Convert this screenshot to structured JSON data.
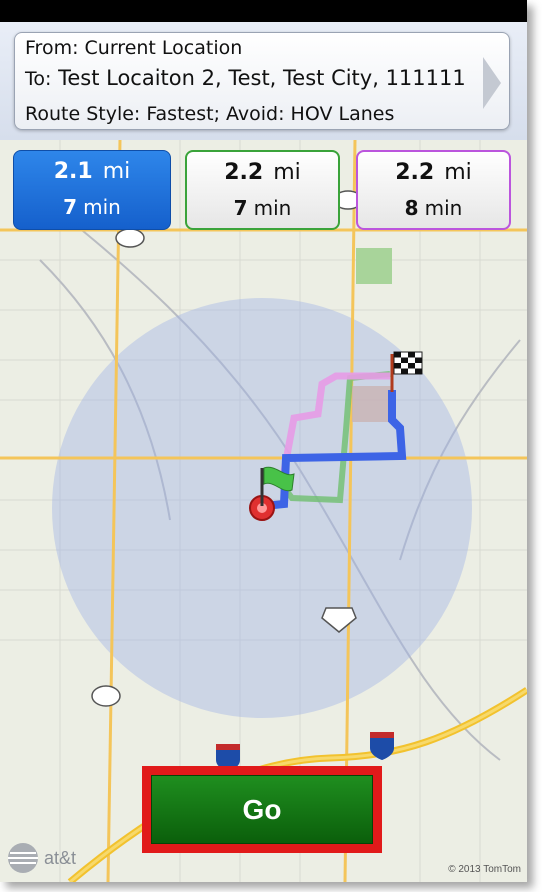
{
  "route": {
    "from_text": "From: Current Location",
    "to_label": "To:",
    "to_value": "Test Locaiton 2, Test, Test City, 111111",
    "style_text": "Route Style: Fastest; Avoid: HOV Lanes"
  },
  "options": [
    {
      "distance": "2.1",
      "distance_unit": "mi",
      "time": "7",
      "time_unit": "min",
      "color": "#1a6fe0"
    },
    {
      "distance": "2.2",
      "distance_unit": "mi",
      "time": "7",
      "time_unit": "min",
      "color": "#3aa33a"
    },
    {
      "distance": "2.2",
      "distance_unit": "mi",
      "time": "8",
      "time_unit": "min",
      "color": "#bb55dd"
    }
  ],
  "go_label": "Go",
  "carrier": "at&t",
  "copyright": "© 2013 TomTom",
  "colors": {
    "accent": "#1a6fe0",
    "go_button": "#137813",
    "highlight": "#e11a1a"
  }
}
